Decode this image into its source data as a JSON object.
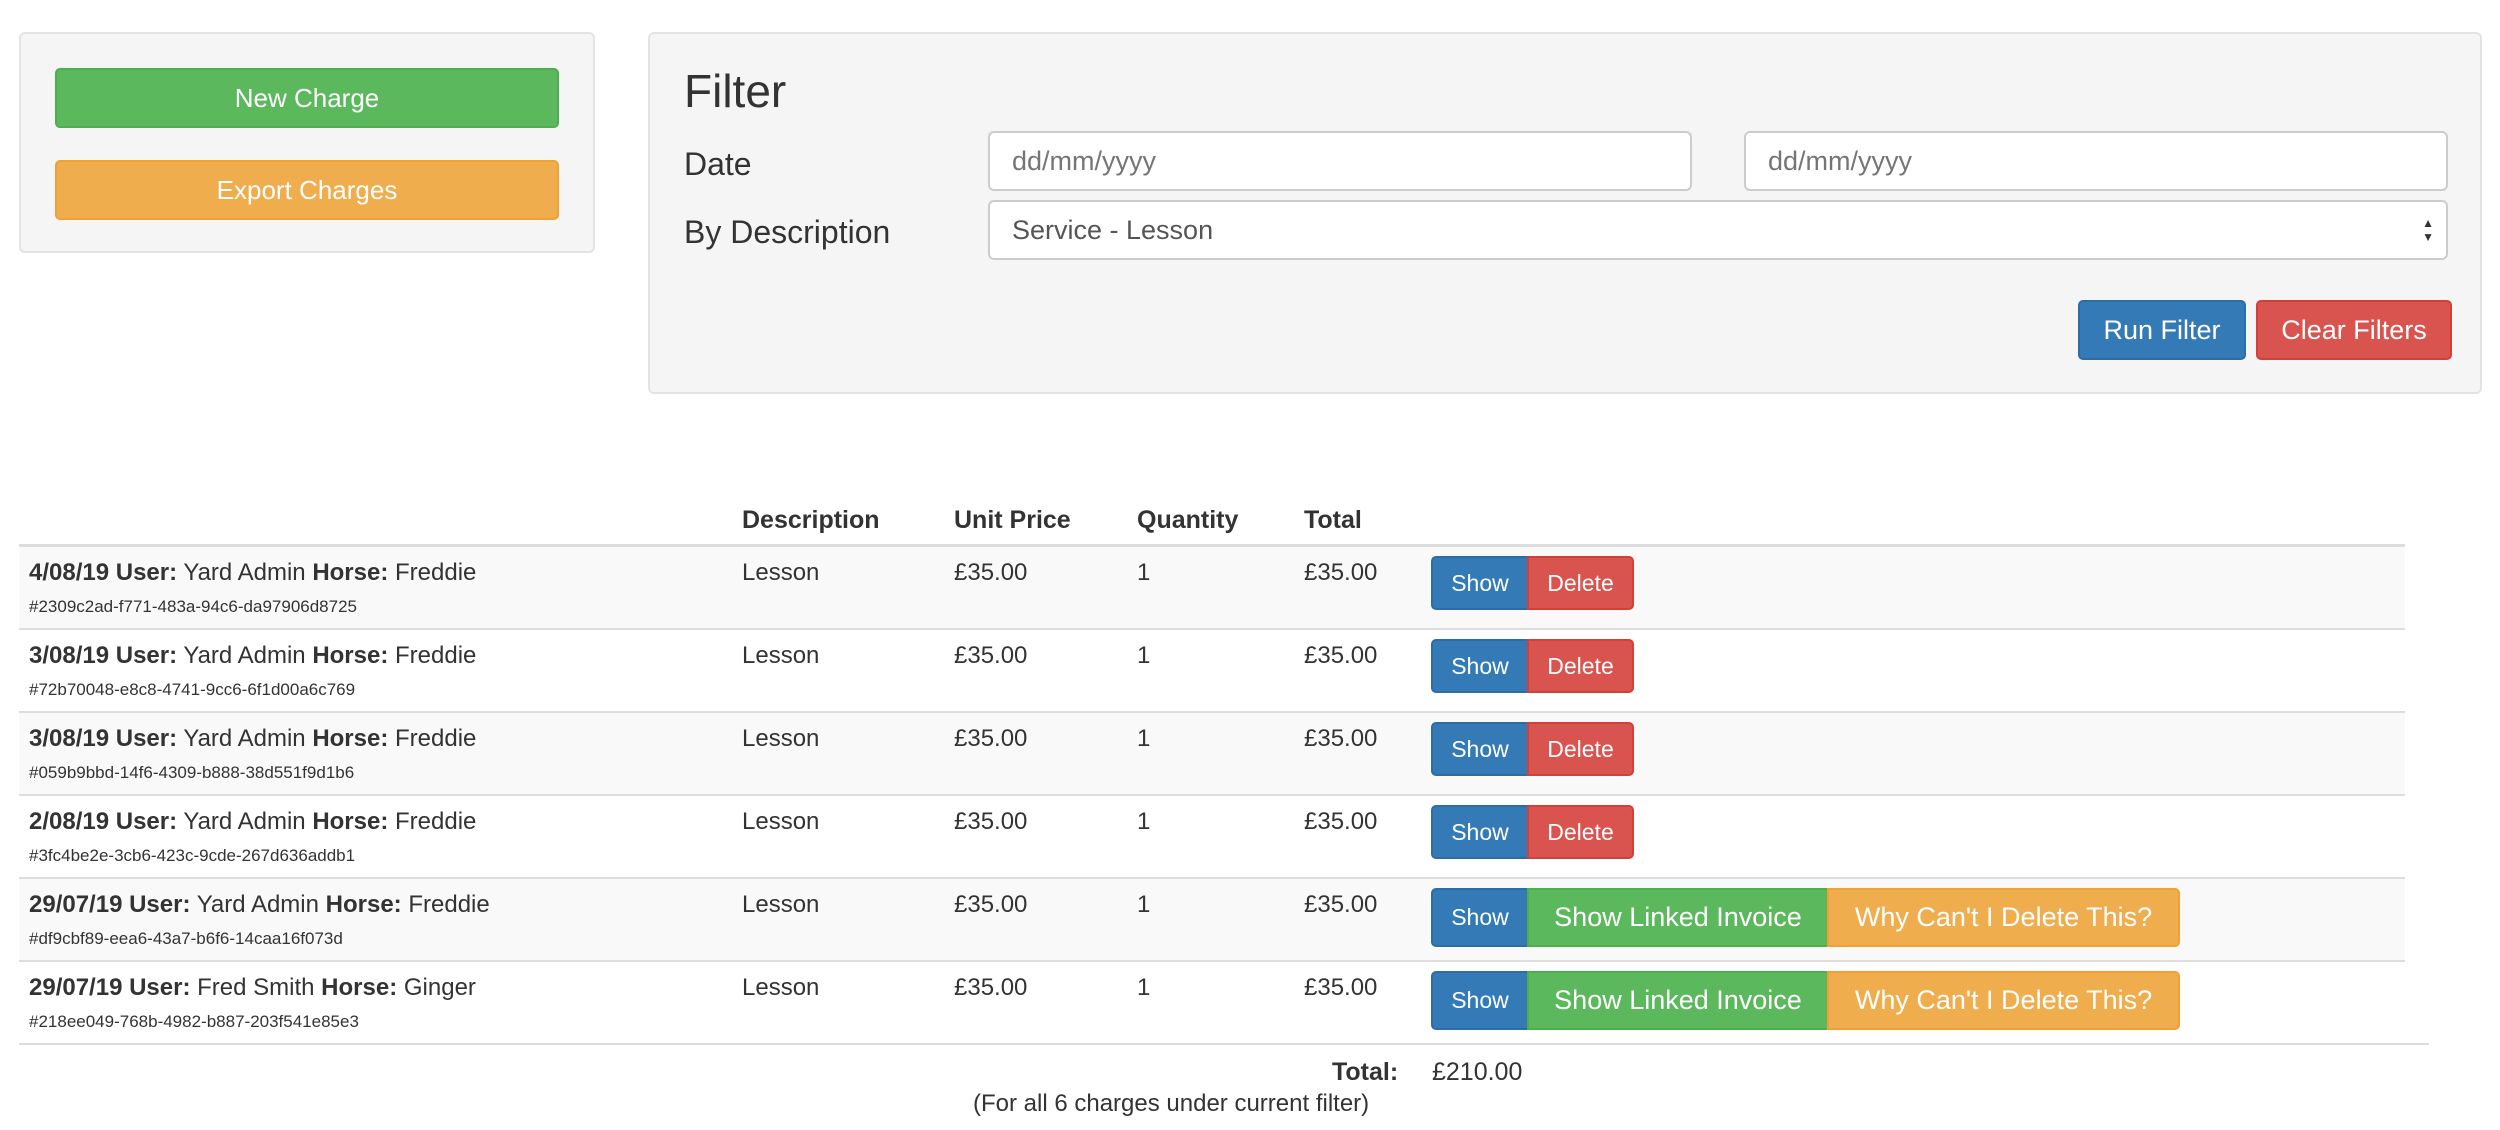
{
  "actions": {
    "new_charge_label": "New Charge",
    "export_label": "Export Charges"
  },
  "filter": {
    "title": "Filter",
    "date_label": "Date",
    "date_from_placeholder": "dd/mm/yyyy",
    "date_to_placeholder": "dd/mm/yyyy",
    "description_label": "By Description",
    "description_selected": "Service - Lesson",
    "run_label": "Run Filter",
    "clear_label": "Clear Filters"
  },
  "table": {
    "headers": {
      "description": "Description",
      "unit_price": "Unit Price",
      "quantity": "Quantity",
      "total": "Total"
    },
    "user_label": "User:",
    "horse_label": "Horse:",
    "rows": [
      {
        "date": "4/08/19",
        "user": "Yard Admin",
        "horse": "Freddie",
        "id": "#2309c2ad-f771-483a-94c6-da97906d8725",
        "description": "Lesson",
        "unit_price": "£35.00",
        "quantity": "1",
        "total": "£35.00",
        "show_label": "Show",
        "delete_label": "Delete"
      },
      {
        "date": "3/08/19",
        "user": "Yard Admin",
        "horse": "Freddie",
        "id": "#72b70048-e8c8-4741-9cc6-6f1d00a6c769",
        "description": "Lesson",
        "unit_price": "£35.00",
        "quantity": "1",
        "total": "£35.00",
        "show_label": "Show",
        "delete_label": "Delete"
      },
      {
        "date": "3/08/19",
        "user": "Yard Admin",
        "horse": "Freddie",
        "id": "#059b9bbd-14f6-4309-b888-38d551f9d1b6",
        "description": "Lesson",
        "unit_price": "£35.00",
        "quantity": "1",
        "total": "£35.00",
        "show_label": "Show",
        "delete_label": "Delete"
      },
      {
        "date": "2/08/19",
        "user": "Yard Admin",
        "horse": "Freddie",
        "id": "#3fc4be2e-3cb6-423c-9cde-267d636addb1",
        "description": "Lesson",
        "unit_price": "£35.00",
        "quantity": "1",
        "total": "£35.00",
        "show_label": "Show",
        "delete_label": "Delete"
      },
      {
        "date": "29/07/19",
        "user": "Yard Admin",
        "horse": "Freddie",
        "id": "#df9cbf89-eea6-43a7-b6f6-14caa16f073d",
        "description": "Lesson",
        "unit_price": "£35.00",
        "quantity": "1",
        "total": "£35.00",
        "show_label": "Show",
        "linked_label": "Show Linked Invoice",
        "why_label": "Why Can't I Delete This?"
      },
      {
        "date": "29/07/19",
        "user": "Fred Smith",
        "horse": "Ginger",
        "id": "#218ee049-768b-4982-b887-203f541e85e3",
        "description": "Lesson",
        "unit_price": "£35.00",
        "quantity": "1",
        "total": "£35.00",
        "show_label": "Show",
        "linked_label": "Show Linked Invoice",
        "why_label": "Why Can't I Delete This?"
      }
    ]
  },
  "summary": {
    "total_label": "Total:",
    "total_value": "£210.00",
    "note": "(For all 6 charges under current filter)"
  }
}
